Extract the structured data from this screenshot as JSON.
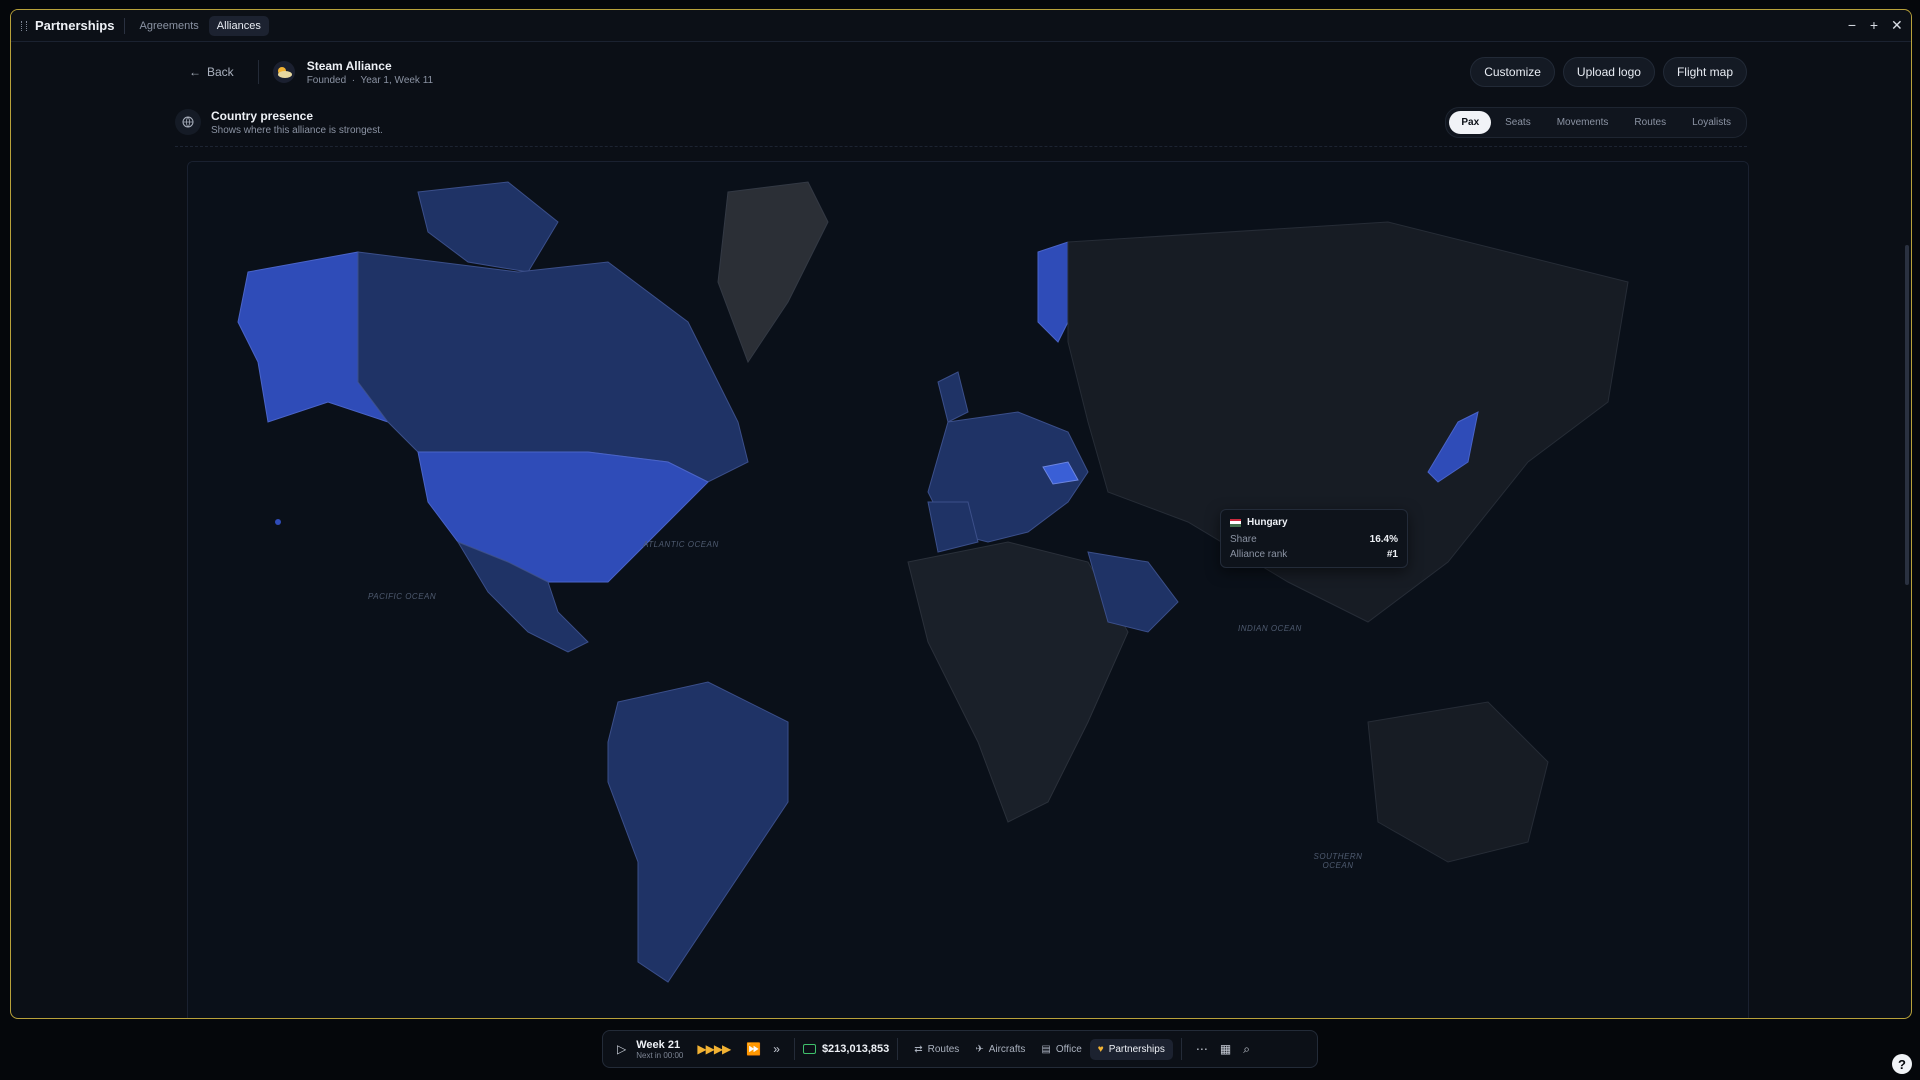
{
  "window": {
    "title": "Partnerships",
    "tabs": [
      {
        "label": "Agreements",
        "active": false
      },
      {
        "label": "Alliances",
        "active": true
      }
    ]
  },
  "header": {
    "back_label": "Back",
    "alliance_name": "Steam Alliance",
    "founded_label": "Founded",
    "founded_value": "Year 1, Week 11",
    "buttons": [
      "Customize",
      "Upload logo",
      "Flight map"
    ]
  },
  "presence": {
    "title": "Country presence",
    "subtitle": "Shows where this alliance is strongest.",
    "metrics": [
      {
        "label": "Pax",
        "active": true
      },
      {
        "label": "Seats",
        "active": false
      },
      {
        "label": "Movements",
        "active": false
      },
      {
        "label": "Routes",
        "active": false
      },
      {
        "label": "Loyalists",
        "active": false
      }
    ]
  },
  "map": {
    "oceans": [
      "ATLANTIC OCEAN",
      "PACIFIC OCEAN",
      "INDIAN OCEAN",
      "SOUTHERN OCEAN"
    ],
    "highlight_color": "#2f4cb8",
    "member_color": "#1f3366",
    "tooltip": {
      "country": "Hungary",
      "share_label": "Share",
      "share_value": "16.4%",
      "rank_label": "Alliance rank",
      "rank_value": "#1"
    }
  },
  "taskbar": {
    "week": "Week 21",
    "next": "Next in 00:00",
    "money": "$213,013,853",
    "nav": [
      {
        "label": "Routes",
        "icon": "routes-icon",
        "active": false
      },
      {
        "label": "Aircrafts",
        "icon": "plane-icon",
        "active": false
      },
      {
        "label": "Office",
        "icon": "office-icon",
        "active": false
      },
      {
        "label": "Partnerships",
        "icon": "handshake-icon",
        "active": true
      }
    ]
  }
}
